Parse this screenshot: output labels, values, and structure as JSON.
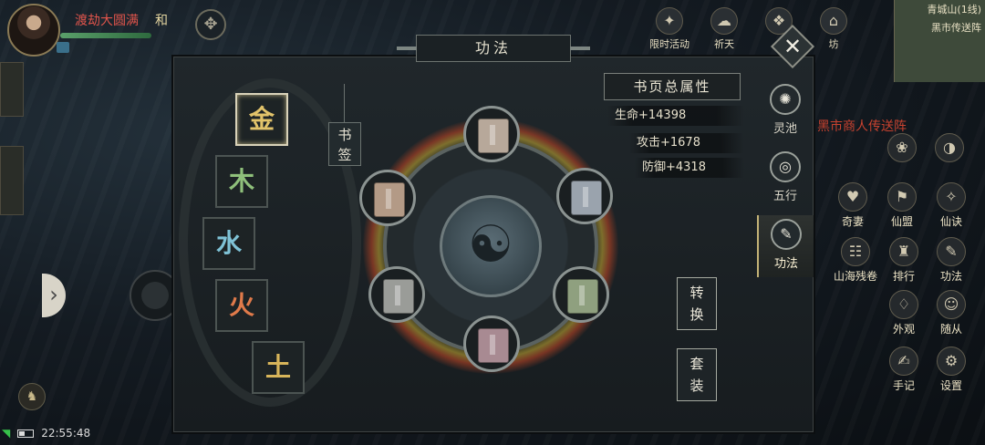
{
  "player": {
    "name": "渡劫大圆满",
    "tag": "和"
  },
  "top_icons": [
    {
      "label": "限时活动",
      "icon": "event-icon",
      "glyph": "✦"
    },
    {
      "label": "祈天",
      "icon": "pray-icon",
      "glyph": "☁"
    },
    {
      "label": "",
      "icon": "scroll-icon",
      "glyph": "❖"
    },
    {
      "label": "坊",
      "icon": "shop-icon",
      "glyph": "⌂"
    }
  ],
  "minimap": {
    "title": "青城山(1线)",
    "sub": "黑市传送阵"
  },
  "zone_hint": "黑市商人传送阵",
  "panel": {
    "title": "功法",
    "close": "✕",
    "bookmark": [
      "书",
      "签"
    ],
    "stats_title": "书页总属性",
    "stats": [
      "生命+14398",
      "攻击+1678",
      "防御+4318"
    ],
    "convert_btn": [
      "转",
      "换"
    ],
    "set_btn": [
      "套",
      "装"
    ],
    "core_glyph": "☯"
  },
  "elements": [
    {
      "label": "金",
      "color": "#e2c36a",
      "active": true
    },
    {
      "label": "木",
      "color": "#8fc07b",
      "active": false
    },
    {
      "label": "水",
      "color": "#7fc2d6",
      "active": false
    },
    {
      "label": "火",
      "color": "#e07a4a",
      "active": false
    },
    {
      "label": "土",
      "color": "#d8b55a",
      "active": false
    }
  ],
  "slots": [
    {
      "name": "book-page-top",
      "color": "#b7a89a"
    },
    {
      "name": "book-page-upper-right",
      "color": "#9aa3ad"
    },
    {
      "name": "book-page-lower-right",
      "color": "#8fa07f"
    },
    {
      "name": "book-page-bottom",
      "color": "#a88a92"
    },
    {
      "name": "book-page-lower-left",
      "color": "#9a9c98"
    },
    {
      "name": "book-page-upper-left",
      "color": "#b39a86"
    }
  ],
  "right_nav": [
    {
      "label": "灵池",
      "icon": "spirit-pool-icon",
      "glyph": "✺",
      "active": false
    },
    {
      "label": "五行",
      "icon": "five-elements-icon",
      "glyph": "◎",
      "active": false
    },
    {
      "label": "功法",
      "icon": "technique-icon",
      "glyph": "✎",
      "active": true
    }
  ],
  "side_functions": [
    {
      "label": "",
      "icon": "bag-icon",
      "glyph": "❀"
    },
    {
      "label": "",
      "icon": "compass-icon",
      "glyph": "◑"
    },
    {
      "label": "奇妻",
      "icon": "spouse-icon",
      "glyph": "♥"
    },
    {
      "label": "仙盟",
      "icon": "alliance-icon",
      "glyph": "⚑"
    },
    {
      "label": "仙诀",
      "icon": "formula-icon",
      "glyph": "✧"
    },
    {
      "label": "山海残卷",
      "icon": "scroll-map-icon",
      "glyph": "☷"
    },
    {
      "label": "排行",
      "icon": "ranking-icon",
      "glyph": "♜"
    },
    {
      "label": "功法",
      "icon": "skill-icon",
      "glyph": "✎"
    },
    {
      "label": "外观",
      "icon": "appearance-icon",
      "glyph": "♢"
    },
    {
      "label": "随从",
      "icon": "follower-icon",
      "glyph": "☺"
    },
    {
      "label": "手记",
      "icon": "notes-icon",
      "glyph": "✍"
    },
    {
      "label": "设置",
      "icon": "settings-icon",
      "glyph": "⚙"
    }
  ],
  "status": {
    "time": "22:55:48"
  }
}
